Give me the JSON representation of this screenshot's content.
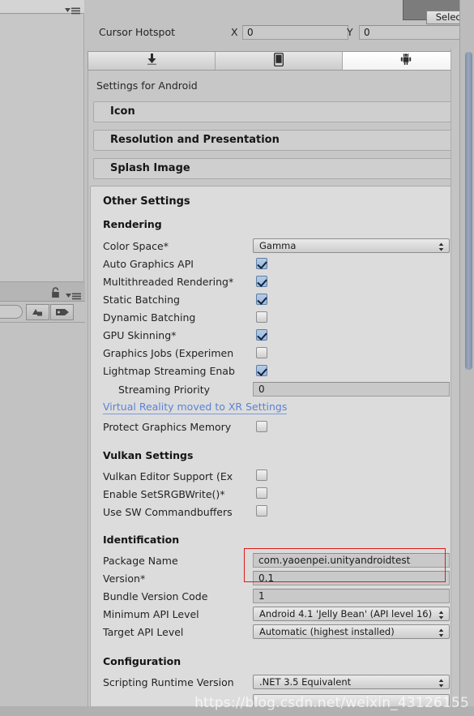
{
  "window": {
    "preview_select_label": "Select",
    "watermark": "https://blog.csdn.net/weixin_43126155"
  },
  "hotspot": {
    "label": "Cursor Hotspot",
    "x_label": "X",
    "x_value": "0",
    "y_label": "Y",
    "y_value": "0"
  },
  "platform_tabs": [
    {
      "name": "standalone",
      "icon": "download-arrow-icon",
      "active": false
    },
    {
      "name": "ios",
      "icon": "phone-icon",
      "active": false
    },
    {
      "name": "android",
      "icon": "android-robot-icon",
      "active": true
    }
  ],
  "settings": {
    "title": "Settings for Android",
    "collapsed_sections": [
      "Icon",
      "Resolution and Presentation",
      "Splash Image"
    ],
    "other_settings_title": "Other Settings",
    "groups": [
      {
        "name": "Rendering",
        "rows": [
          {
            "label": "Color Space*",
            "type": "dropdown",
            "value": "Gamma"
          },
          {
            "label": "Auto Graphics API",
            "type": "checkbox",
            "checked": true
          },
          {
            "label": "Multithreaded Rendering*",
            "type": "checkbox",
            "checked": true
          },
          {
            "label": "Static Batching",
            "type": "checkbox",
            "checked": true
          },
          {
            "label": "Dynamic Batching",
            "type": "checkbox",
            "checked": false
          },
          {
            "label": "GPU Skinning*",
            "type": "checkbox",
            "checked": true
          },
          {
            "label": "Graphics Jobs (Experimen",
            "type": "checkbox",
            "checked": false
          },
          {
            "label": "Lightmap Streaming Enab",
            "type": "checkbox",
            "checked": true
          },
          {
            "label": "Streaming Priority",
            "type": "textfield",
            "value": "0"
          },
          {
            "label": "Virtual Reality moved to XR Settings",
            "type": "link"
          },
          {
            "label": "Protect Graphics Memory",
            "type": "checkbox",
            "checked": false
          }
        ]
      },
      {
        "name": "Vulkan Settings",
        "rows": [
          {
            "label": "Vulkan Editor Support (Ex",
            "type": "checkbox",
            "checked": false
          },
          {
            "label": "Enable SetSRGBWrite()*",
            "type": "checkbox",
            "checked": false
          },
          {
            "label": "Use SW Commandbuffers",
            "type": "checkbox",
            "checked": false
          }
        ]
      },
      {
        "name": "Identification",
        "rows": [
          {
            "label": "Package Name",
            "type": "textfield",
            "value": "com.yaoenpei.unityandroidtest",
            "highlighted": true
          },
          {
            "label": "Version*",
            "type": "textfield",
            "value": "0.1"
          },
          {
            "label": "Bundle Version Code",
            "type": "textfield",
            "value": "1"
          },
          {
            "label": "Minimum API Level",
            "type": "dropdown",
            "value": "Android 4.1 'Jelly Bean' (API level 16)"
          },
          {
            "label": "Target API Level",
            "type": "dropdown",
            "value": "Automatic (highest installed)"
          }
        ]
      },
      {
        "name": "Configuration",
        "rows": [
          {
            "label": "Scripting Runtime Version",
            "type": "dropdown",
            "value": ".NET 3.5 Equivalent"
          }
        ]
      }
    ]
  },
  "colors": {
    "panel_bg": "#c2c2c2",
    "content_bg": "#dcdcdc",
    "accent_link": "#5b82d6",
    "highlight_box": "#e01b1b",
    "checkbox_on": "#a8c4e0",
    "scrollbar_thumb": "#8c9bb0"
  }
}
